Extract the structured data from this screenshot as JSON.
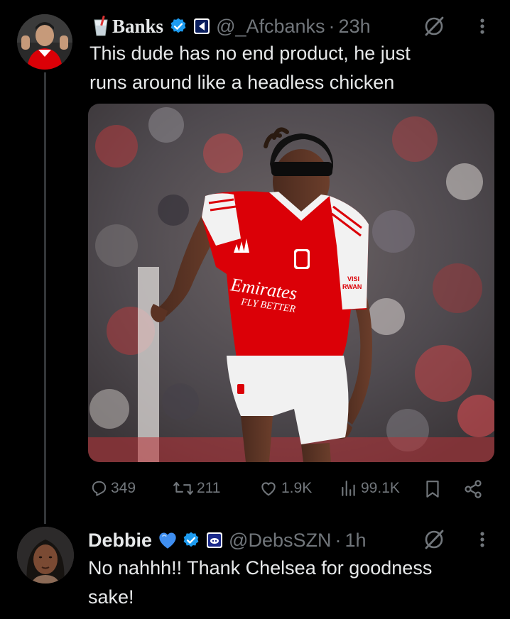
{
  "tweet": {
    "author_name": "Banks",
    "author_handle": "@_Afcbanks",
    "separator": "·",
    "time": "23h",
    "text_line1": "This dude has no end product, he just",
    "text_line2": "runs around like a headless chicken",
    "stats": {
      "replies": "349",
      "reposts": "211",
      "likes": "1.9K",
      "views": "99.1K"
    },
    "photo": {
      "sponsor": "Emirates",
      "sponsor_tagline": "FLY BETTER",
      "sleeve_sponsor_top": "VISI",
      "sleeve_sponsor_bottom": "RWAN"
    }
  },
  "reply": {
    "author_name": "Debbie",
    "author_handle": "@DebsSZN",
    "separator": "·",
    "time": "1h",
    "text_line1": "No nahhh!! Thank Chelsea for goodness",
    "text_line2": "sake!"
  },
  "colors": {
    "background": "#000000",
    "text": "#e7e9ea",
    "muted": "#71767b",
    "verified": "#1d9bf0",
    "arsenal_red": "#db0007"
  }
}
